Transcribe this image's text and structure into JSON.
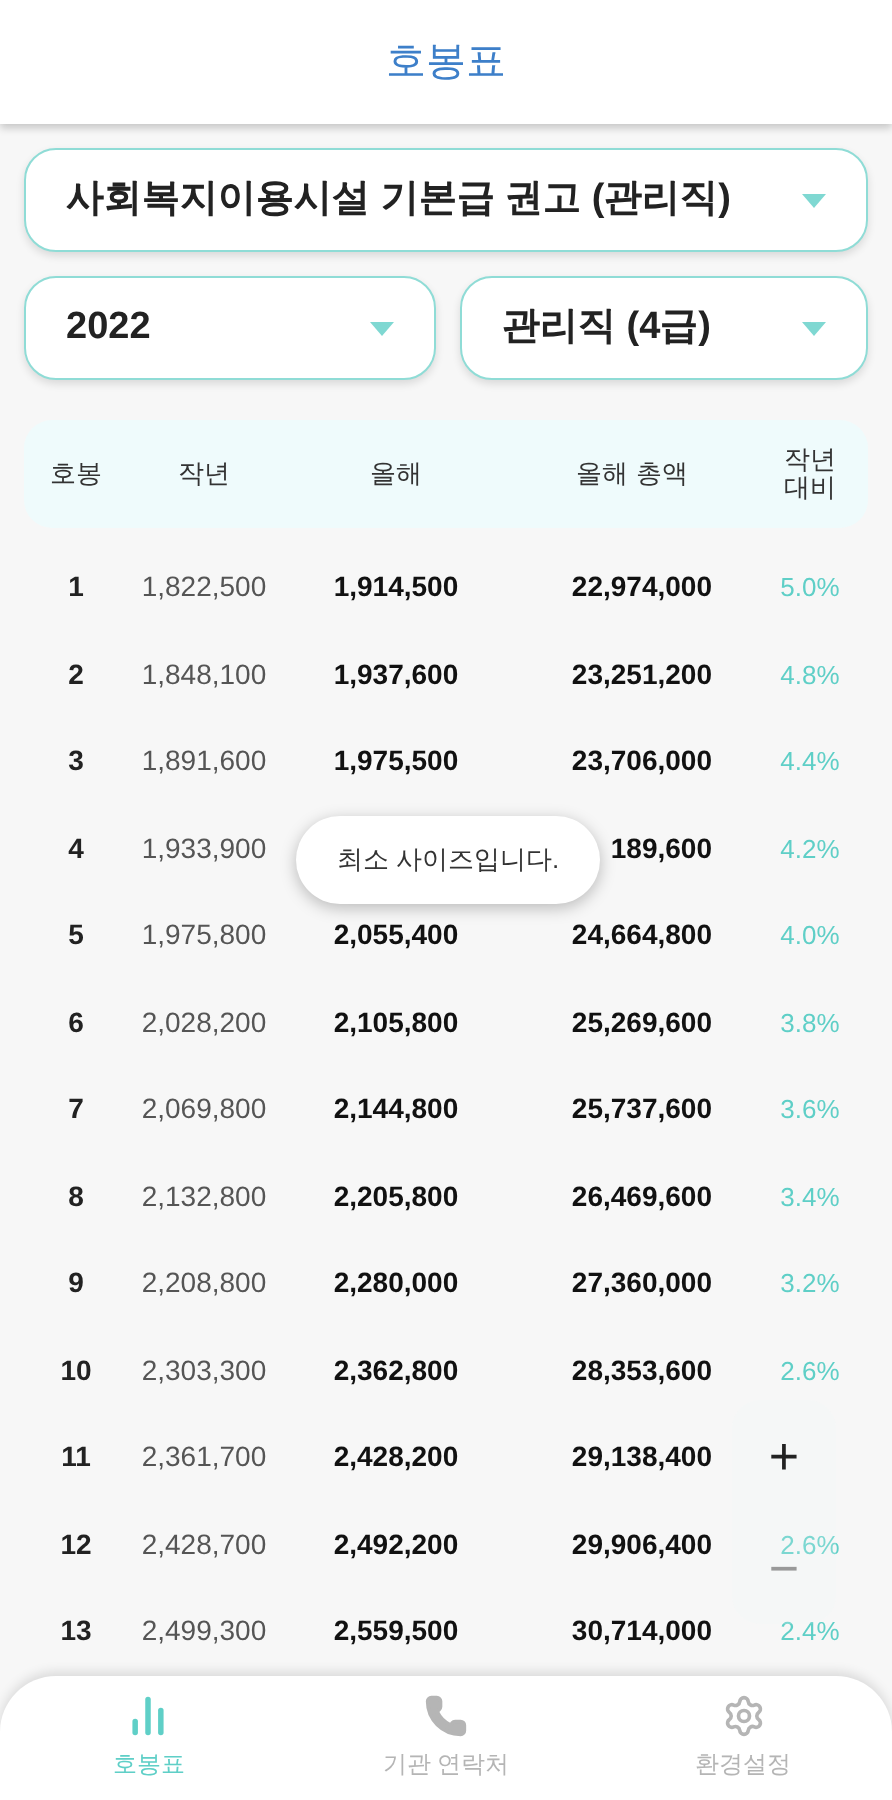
{
  "header": {
    "title": "호봉표"
  },
  "selectors": [
    {
      "value": "사회복지이용시설 기본급 권고 (관리직)"
    },
    {
      "value": "2022"
    },
    {
      "value": "관리직 (4급)"
    }
  ],
  "table": {
    "columns": [
      "호봉",
      "작년",
      "올해",
      "올해 총액",
      "작년\n대비"
    ],
    "rows": [
      {
        "step": "1",
        "last_year": "1,822,500",
        "this_year": "1,914,500",
        "total": "22,974,000",
        "change": "5.0%"
      },
      {
        "step": "2",
        "last_year": "1,848,100",
        "this_year": "1,937,600",
        "total": "23,251,200",
        "change": "4.8%"
      },
      {
        "step": "3",
        "last_year": "1,891,600",
        "this_year": "1,975,500",
        "total": "23,706,000",
        "change": "4.4%"
      },
      {
        "step": "4",
        "last_year": "1,933,900",
        "total": "189,600",
        "change": "4.2%"
      },
      {
        "step": "5",
        "last_year": "1,975,800",
        "this_year": "2,055,400",
        "total": "24,664,800",
        "change": "4.0%"
      },
      {
        "step": "6",
        "last_year": "2,028,200",
        "this_year": "2,105,800",
        "total": "25,269,600",
        "change": "3.8%"
      },
      {
        "step": "7",
        "last_year": "2,069,800",
        "this_year": "2,144,800",
        "total": "25,737,600",
        "change": "3.6%"
      },
      {
        "step": "8",
        "last_year": "2,132,800",
        "this_year": "2,205,800",
        "total": "26,469,600",
        "change": "3.4%"
      },
      {
        "step": "9",
        "last_year": "2,208,800",
        "this_year": "2,280,000",
        "total": "27,360,000",
        "change": "3.2%"
      },
      {
        "step": "10",
        "last_year": "2,303,300",
        "this_year": "2,362,800",
        "total": "28,353,600",
        "change": "2.6%"
      },
      {
        "step": "11",
        "last_year": "2,361,700",
        "this_year": "2,428,200",
        "total": "29,138,400"
      },
      {
        "step": "12",
        "last_year": "2,428,700",
        "this_year": "2,492,200",
        "total": "29,906,400",
        "change": "2.6%"
      },
      {
        "step": "13",
        "last_year": "2,499,300",
        "this_year": "2,559,500",
        "total": "30,714,000",
        "change": "2.4%"
      }
    ]
  },
  "toast": {
    "text": "최소 사이즈입니다."
  },
  "zoom_controls": [
    {
      "kind": "plus",
      "label": "+"
    },
    {
      "kind": "minus",
      "label": "−"
    }
  ],
  "bottom_nav": [
    {
      "kind": "chart",
      "label": "호봉표",
      "selected": true
    },
    {
      "kind": "phone",
      "label": "기관 연락처",
      "selected": false
    },
    {
      "kind": "gear",
      "label": "환경설정",
      "selected": false
    }
  ]
}
